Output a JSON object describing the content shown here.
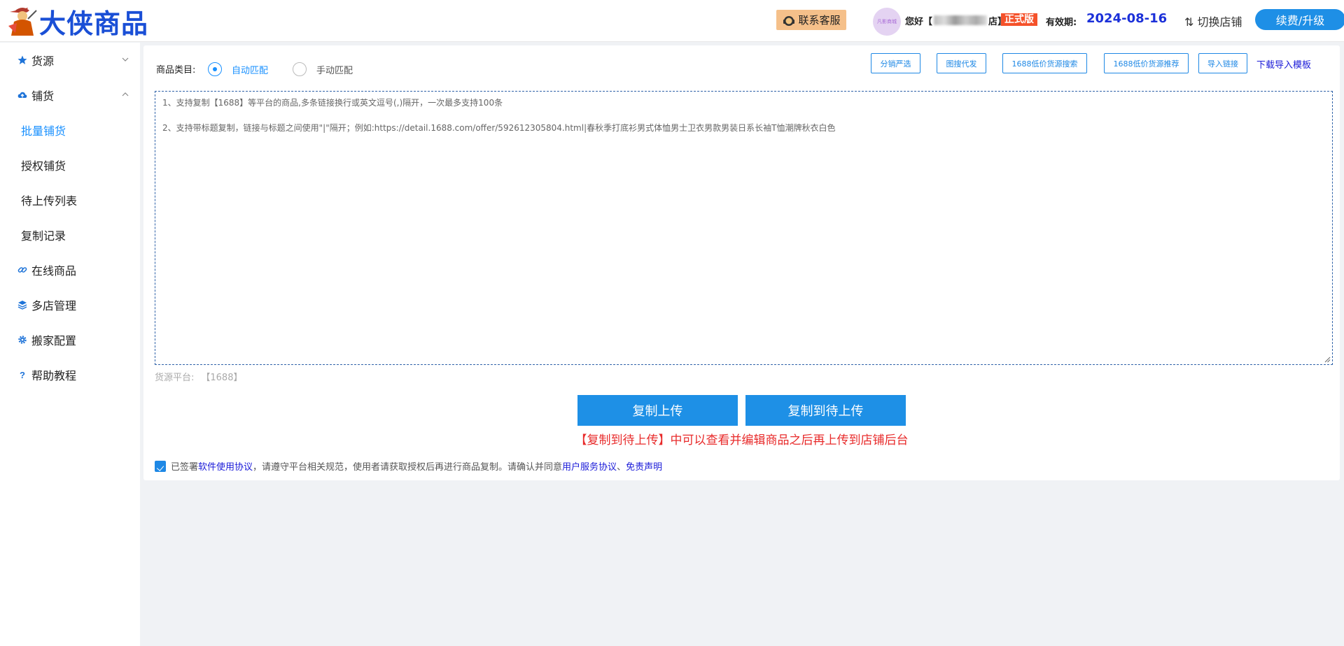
{
  "brand": {
    "name": "大侠商品",
    "mascot_icon": "swordsman-mascot-icon"
  },
  "header": {
    "customer_service": "联系客服",
    "avatar_text": "凡影商城",
    "greeting_prefix": "您好【",
    "greeting_suffix": "店】",
    "edition": "正式版",
    "valid_label": "有效期:",
    "valid_date": "2024-08-16",
    "switch_shop": "⇅ 切换店铺",
    "upgrade": "续费/升级"
  },
  "sidebar": {
    "groups": [
      {
        "label": "货源",
        "icon": "star-icon",
        "expanded": false
      },
      {
        "label": "铺货",
        "icon": "cloud-upload-icon",
        "expanded": true
      }
    ],
    "sub_items": [
      "批量铺货",
      "授权铺货",
      "待上传列表",
      "复制记录"
    ],
    "active_sub": "批量铺货",
    "bottom_items": [
      {
        "label": "在线商品",
        "icon": "link-icon"
      },
      {
        "label": "多店管理",
        "icon": "layers-icon"
      },
      {
        "label": "搬家配置",
        "icon": "gear-icon"
      },
      {
        "label": "帮助教程",
        "icon": "question-icon"
      }
    ]
  },
  "form": {
    "category_label": "商品类目:",
    "options": [
      "自动匹配",
      "手动匹配"
    ],
    "selected": "自动匹配",
    "tools": [
      "分销严选",
      "图搜代发",
      "1688低价货源搜索",
      "1688低价货源推荐",
      "导入链接"
    ],
    "download_template": "下载导入模板",
    "placeholder_line1": "1、支持复制【1688】等平台的商品,多条链接换行或英文逗号(,)隔开，一次最多支持100条",
    "placeholder_line2": "2、支持带标题复制，链接与标题之间使用\"|\"隔开；例如:https://detail.1688.com/offer/592612305804.html|春秋季打底衫男式体恤男士卫衣男款男装日系长袖T恤潮牌秋衣白色",
    "source_label": "货源平台:",
    "source_value": "【1688】",
    "btn_copy_upload": "复制上传",
    "btn_copy_pending": "复制到待上传",
    "hint": "【复制到待上传】中可以查看并编辑商品之后再上传到店铺后台",
    "agreement": {
      "checked": true,
      "text1": "已签署",
      "link1": "软件使用协议",
      "text2": "，请遵守平台相关规范，使用者请获取授权后再进行商品复制。请确认并同意",
      "link2": "用户服务协议",
      "sep": "、",
      "link3": "免责声明"
    }
  },
  "colors": {
    "primary": "#1e90e6",
    "brand": "#1a4fd6",
    "edition": "#f5512a",
    "hint": "#e82b2b"
  }
}
